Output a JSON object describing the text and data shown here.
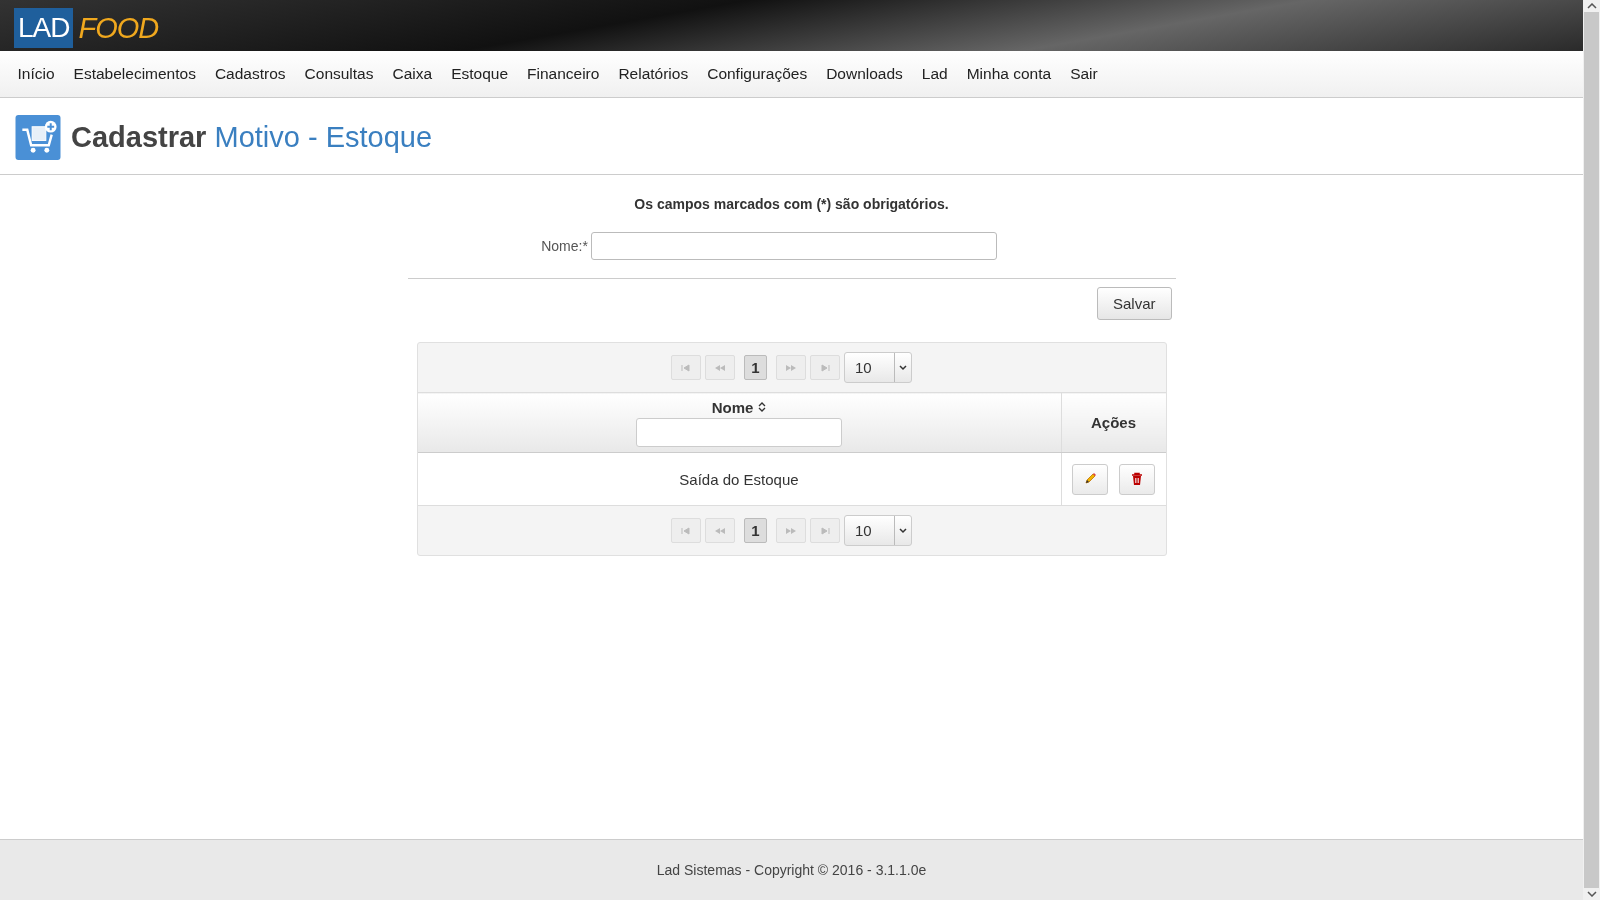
{
  "logo": {
    "part_1": "LAD",
    "part_2": "FOOD"
  },
  "nav": [
    {
      "label": "Início"
    },
    {
      "label": "Estabelecimentos"
    },
    {
      "label": "Cadastros"
    },
    {
      "label": "Consultas"
    },
    {
      "label": "Caixa"
    },
    {
      "label": "Estoque"
    },
    {
      "label": "Financeiro"
    },
    {
      "label": "Relatórios"
    },
    {
      "label": "Configurações"
    },
    {
      "label": "Downloads"
    },
    {
      "label": "Lad"
    },
    {
      "label": "Minha conta"
    },
    {
      "label": "Sair"
    }
  ],
  "page_title": {
    "verb": "Cadastrar",
    "subject": "Motivo - Estoque"
  },
  "form": {
    "note": "Os campos marcados com (*) são obrigatórios.",
    "fields": [
      {
        "label": "Nome:*"
      }
    ],
    "submit": "Salvar"
  },
  "table": {
    "pagers": [
      {
        "nav_disabled": true,
        "pages": [
          {
            "label": "1",
            "selected": true
          }
        ],
        "page_size": "10"
      },
      {
        "nav_disabled": true,
        "pages": [
          {
            "label": "1",
            "selected": true
          }
        ],
        "page_size": "10"
      }
    ],
    "columns": [
      {
        "label": "Nome",
        "sortable": true,
        "filter": true
      },
      {
        "label": "Ações",
        "sortable": false,
        "filter": false
      }
    ],
    "rows": [
      {
        "nome": "Saída do Estoque"
      }
    ]
  },
  "footer": "Lad Sistemas - Copyright © 2016 - 3.1.1.0e"
}
